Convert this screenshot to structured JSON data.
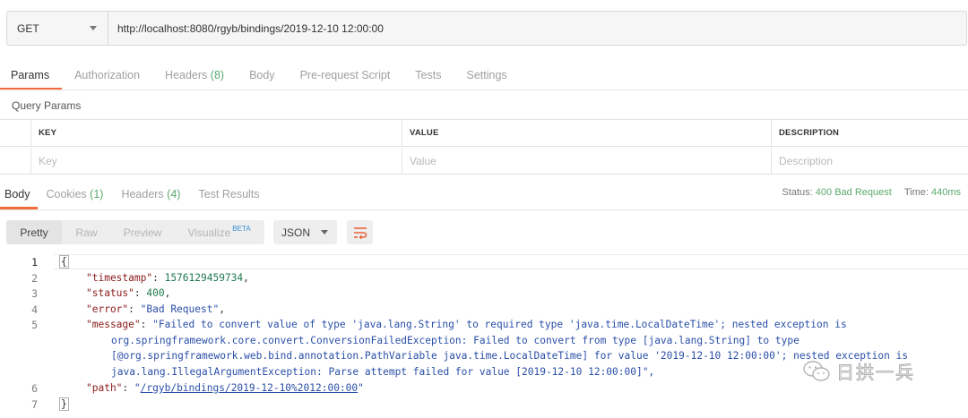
{
  "request": {
    "method": "GET",
    "url": "http://localhost:8080/rgyb/bindings/2019-12-10 12:00:00"
  },
  "request_tabs": [
    {
      "label": "Params",
      "count": "",
      "active": true
    },
    {
      "label": "Authorization",
      "count": "",
      "active": false
    },
    {
      "label": "Headers",
      "count": "(8)",
      "active": false
    },
    {
      "label": "Body",
      "count": "",
      "active": false
    },
    {
      "label": "Pre-request Script",
      "count": "",
      "active": false
    },
    {
      "label": "Tests",
      "count": "",
      "active": false
    },
    {
      "label": "Settings",
      "count": "",
      "active": false
    }
  ],
  "query_params": {
    "title": "Query Params",
    "columns": [
      "KEY",
      "VALUE",
      "DESCRIPTION"
    ],
    "placeholders": {
      "key": "Key",
      "value": "Value",
      "description": "Description"
    }
  },
  "response_tabs": [
    {
      "label": "Body",
      "count": "",
      "active": true
    },
    {
      "label": "Cookies",
      "count": "(1)",
      "active": false
    },
    {
      "label": "Headers",
      "count": "(4)",
      "active": false
    },
    {
      "label": "Test Results",
      "count": "",
      "active": false
    }
  ],
  "status": {
    "status_label": "Status:",
    "status_value": "400 Bad Request",
    "time_label": "Time:",
    "time_value": "440ms"
  },
  "body_toolbar": {
    "formats": [
      {
        "label": "Pretty",
        "active": true
      },
      {
        "label": "Raw",
        "active": false
      },
      {
        "label": "Preview",
        "active": false
      },
      {
        "label": "Visualize",
        "active": false,
        "badge": "BETA"
      }
    ],
    "language": "JSON",
    "wrap_icon": "wrap-lines-icon"
  },
  "code": {
    "line_numbers": [
      "1",
      "2",
      "3",
      "4",
      "5",
      "6",
      "7"
    ],
    "open_brace": "{",
    "close_brace": "}",
    "timestamp_key": "\"timestamp\"",
    "timestamp_value": "1576129459734",
    "status_key": "\"status\"",
    "status_value": "400",
    "error_key": "\"error\"",
    "error_value": "\"Bad Request\"",
    "message_key": "\"message\"",
    "message_lines": [
      "\"Failed to convert value of type 'java.lang.String' to required type 'java.time.LocalDateTime'; nested exception is",
      "org.springframework.core.convert.ConversionFailedException: Failed to convert from type [java.lang.String] to type",
      "[@org.springframework.web.bind.annotation.PathVariable java.time.LocalDateTime] for value '2019-12-10 12:00:00'; nested exception is",
      "java.lang.IllegalArgumentException: Parse attempt failed for value [2019-12-10 12:00:00]\","
    ],
    "path_key": "\"path\"",
    "path_value": "/rgyb/bindings/2019-12-10%2012:00:00"
  },
  "watermark": {
    "text": "日拱一兵",
    "icon": "wechat-icon"
  }
}
